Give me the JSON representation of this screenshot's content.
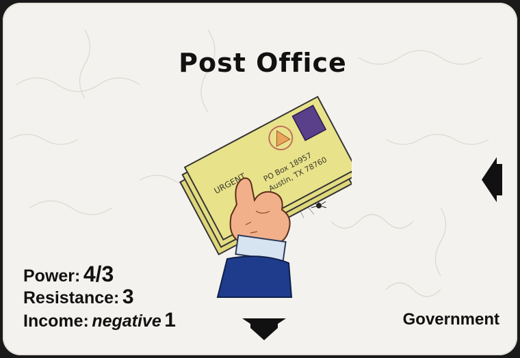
{
  "card": {
    "title": "Post Office",
    "stats": {
      "power_label": "Power:",
      "power_value": "4/3",
      "resistance_label": "Resistance:",
      "resistance_value": "3",
      "income_label": "Income:",
      "income_qualifier": "negative",
      "income_value": "1"
    },
    "alignment": "Government",
    "envelope": {
      "label": "URGENT",
      "address_line1": "PO Box 18957",
      "address_line2": "Austin, TX 78760"
    },
    "arrows": [
      "arrow-left-icon",
      "arrow-down-icon"
    ],
    "colors": {
      "card_bg": "#f4f2ee",
      "text": "#111111",
      "envelope": "#e8e28a",
      "sleeve": "#1f3c8c"
    }
  }
}
